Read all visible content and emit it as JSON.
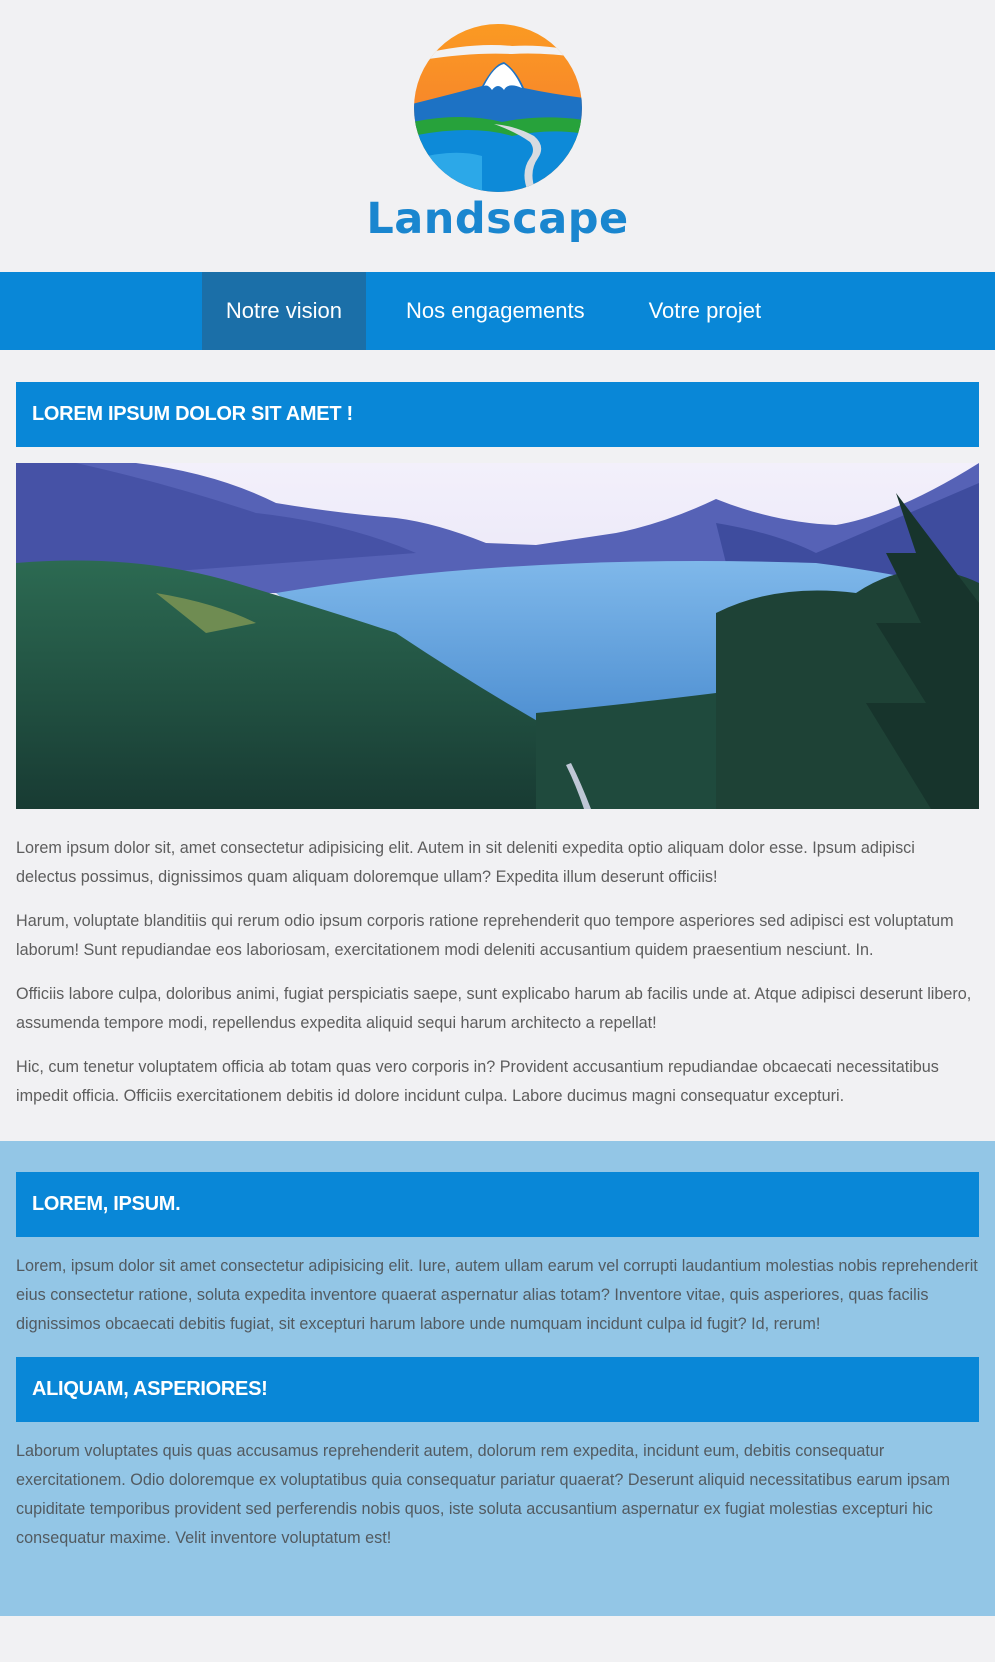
{
  "brand": {
    "name": "Landscape"
  },
  "nav": {
    "items": [
      {
        "label": "Notre vision",
        "active": true
      },
      {
        "label": "Nos engagements",
        "active": false
      },
      {
        "label": "Votre projet",
        "active": false
      }
    ]
  },
  "main": {
    "heading": "LOREM IPSUM DOLOR SIT AMET !",
    "paragraphs": [
      "Lorem ipsum dolor sit, amet consectetur adipisicing elit. Autem in sit deleniti expedita optio aliquam dolor esse. Ipsum adipisci delectus possimus, dignissimos quam aliquam doloremque ullam? Expedita illum deserunt officiis!",
      "Harum, voluptate blanditiis qui rerum odio ipsum corporis ratione reprehenderit quo tempore asperiores sed adipisci est voluptatum laborum! Sunt repudiandae eos laboriosam, exercitationem modi deleniti accusantium quidem praesentium nesciunt. In.",
      "Officiis labore culpa, doloribus animi, fugiat perspiciatis saepe, sunt explicabo harum ab facilis unde at. Atque adipisci deserunt libero, assumenda tempore modi, repellendus expedita aliquid sequi harum architecto a repellat!",
      "Hic, cum tenetur voluptatem officia ab totam quas vero corporis in? Provident accusantium repudiandae obcaecati necessitatibus impedit officia. Officiis exercitationem debitis id dolore incidunt culpa. Labore ducimus magni consequatur excepturi."
    ]
  },
  "secondary": {
    "blocks": [
      {
        "heading": "LOREM, IPSUM.",
        "text": "Lorem, ipsum dolor sit amet consectetur adipisicing elit. Iure, autem ullam earum vel corrupti laudantium molestias nobis reprehenderit eius consectetur ratione, soluta expedita inventore quaerat aspernatur alias totam? Inventore vitae, quis asperiores, quas facilis dignissimos obcaecati debitis fugiat, sit excepturi harum labore unde numquam incidunt culpa id fugit? Id, rerum!"
      },
      {
        "heading": "ALIQUAM, ASPERIORES!",
        "text": "Laborum voluptates quis quas accusamus reprehenderit autem, dolorum rem expedita, incidunt eum, debitis consequatur exercitationem. Odio doloremque ex voluptatibus quia consequatur pariatur quaerat? Deserunt aliquid necessitatibus earum ipsam cupiditate temporibus provident sed perferendis nobis quos, iste soluta accusantium aspernatur ex fugiat molestias excepturi hic consequatur maxime. Velit inventore voluptatum est!"
      }
    ]
  },
  "colors": {
    "accent": "#0987d7",
    "nav_active": "#1b6fa8",
    "page_bg": "#f1f1f3",
    "secondary_bg": "#93c6e6",
    "brand_text": "#1a86cf"
  }
}
